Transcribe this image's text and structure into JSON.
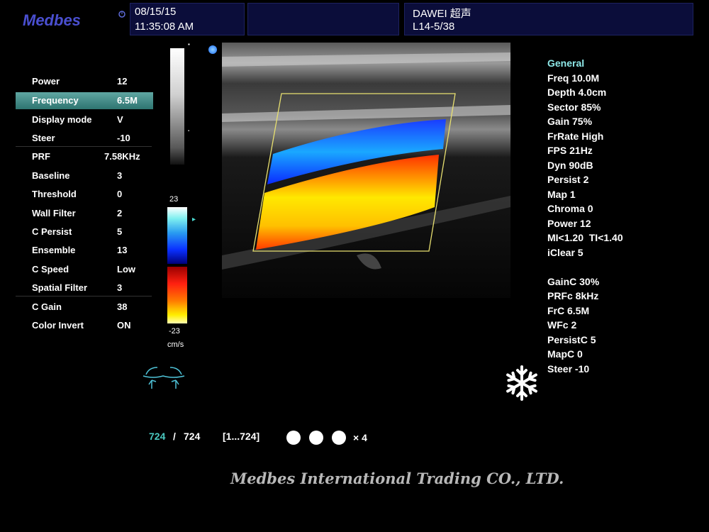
{
  "brand": {
    "logo": "Medbes"
  },
  "header": {
    "date": "08/15/15",
    "time": "11:35:08 AM",
    "operator": "DAWEI 超声",
    "probe": "L14-5/38"
  },
  "menu": [
    {
      "label": "Power",
      "value": "12"
    },
    {
      "label": "Frequency",
      "value": "6.5M",
      "selected": true
    },
    {
      "label": "Display mode",
      "value": "V"
    },
    {
      "label": "Steer",
      "value": "-10"
    },
    {
      "label": "PRF",
      "value": "7.58KHz"
    },
    {
      "label": "Baseline",
      "value": "3"
    },
    {
      "label": "Threshold",
      "value": "0"
    },
    {
      "label": "Wall Filter",
      "value": "2"
    },
    {
      "label": "C Persist",
      "value": "5"
    },
    {
      "label": "Ensemble",
      "value": "13"
    },
    {
      "label": "C Speed",
      "value": "Low"
    },
    {
      "label": "Spatial Filter",
      "value": "3"
    },
    {
      "label": "C Gain",
      "value": "38"
    },
    {
      "label": "Color Invert",
      "value": "ON"
    }
  ],
  "colorbar": {
    "top": "23",
    "bottom": "-23",
    "unit": "cm/s"
  },
  "params": {
    "general": "General",
    "group1": [
      "Freq 10.0M",
      "Depth 4.0cm",
      "Sector 85%",
      "Gain 75%",
      "FrRate High",
      "FPS 21Hz",
      "Dyn 90dB",
      "Persist 2",
      "Map 1",
      "Chroma 0",
      "Power 12",
      "MI<1.20  TI<1.40",
      "iClear 5"
    ],
    "group2": [
      "GainC 30%",
      "PRFc 8kHz",
      "FrC 6.5M",
      "WFc 2",
      "PersistC 5",
      "MapC 0",
      "Steer -10"
    ]
  },
  "cine": {
    "current": "724",
    "sep": "/",
    "total": "724",
    "range": "[1...724]",
    "speed": "× 4"
  },
  "footer": "Medbes International Trading CO., LTD.",
  "icons": {
    "freeze": "snowflake-icon",
    "trackball": "trackball-icon"
  }
}
